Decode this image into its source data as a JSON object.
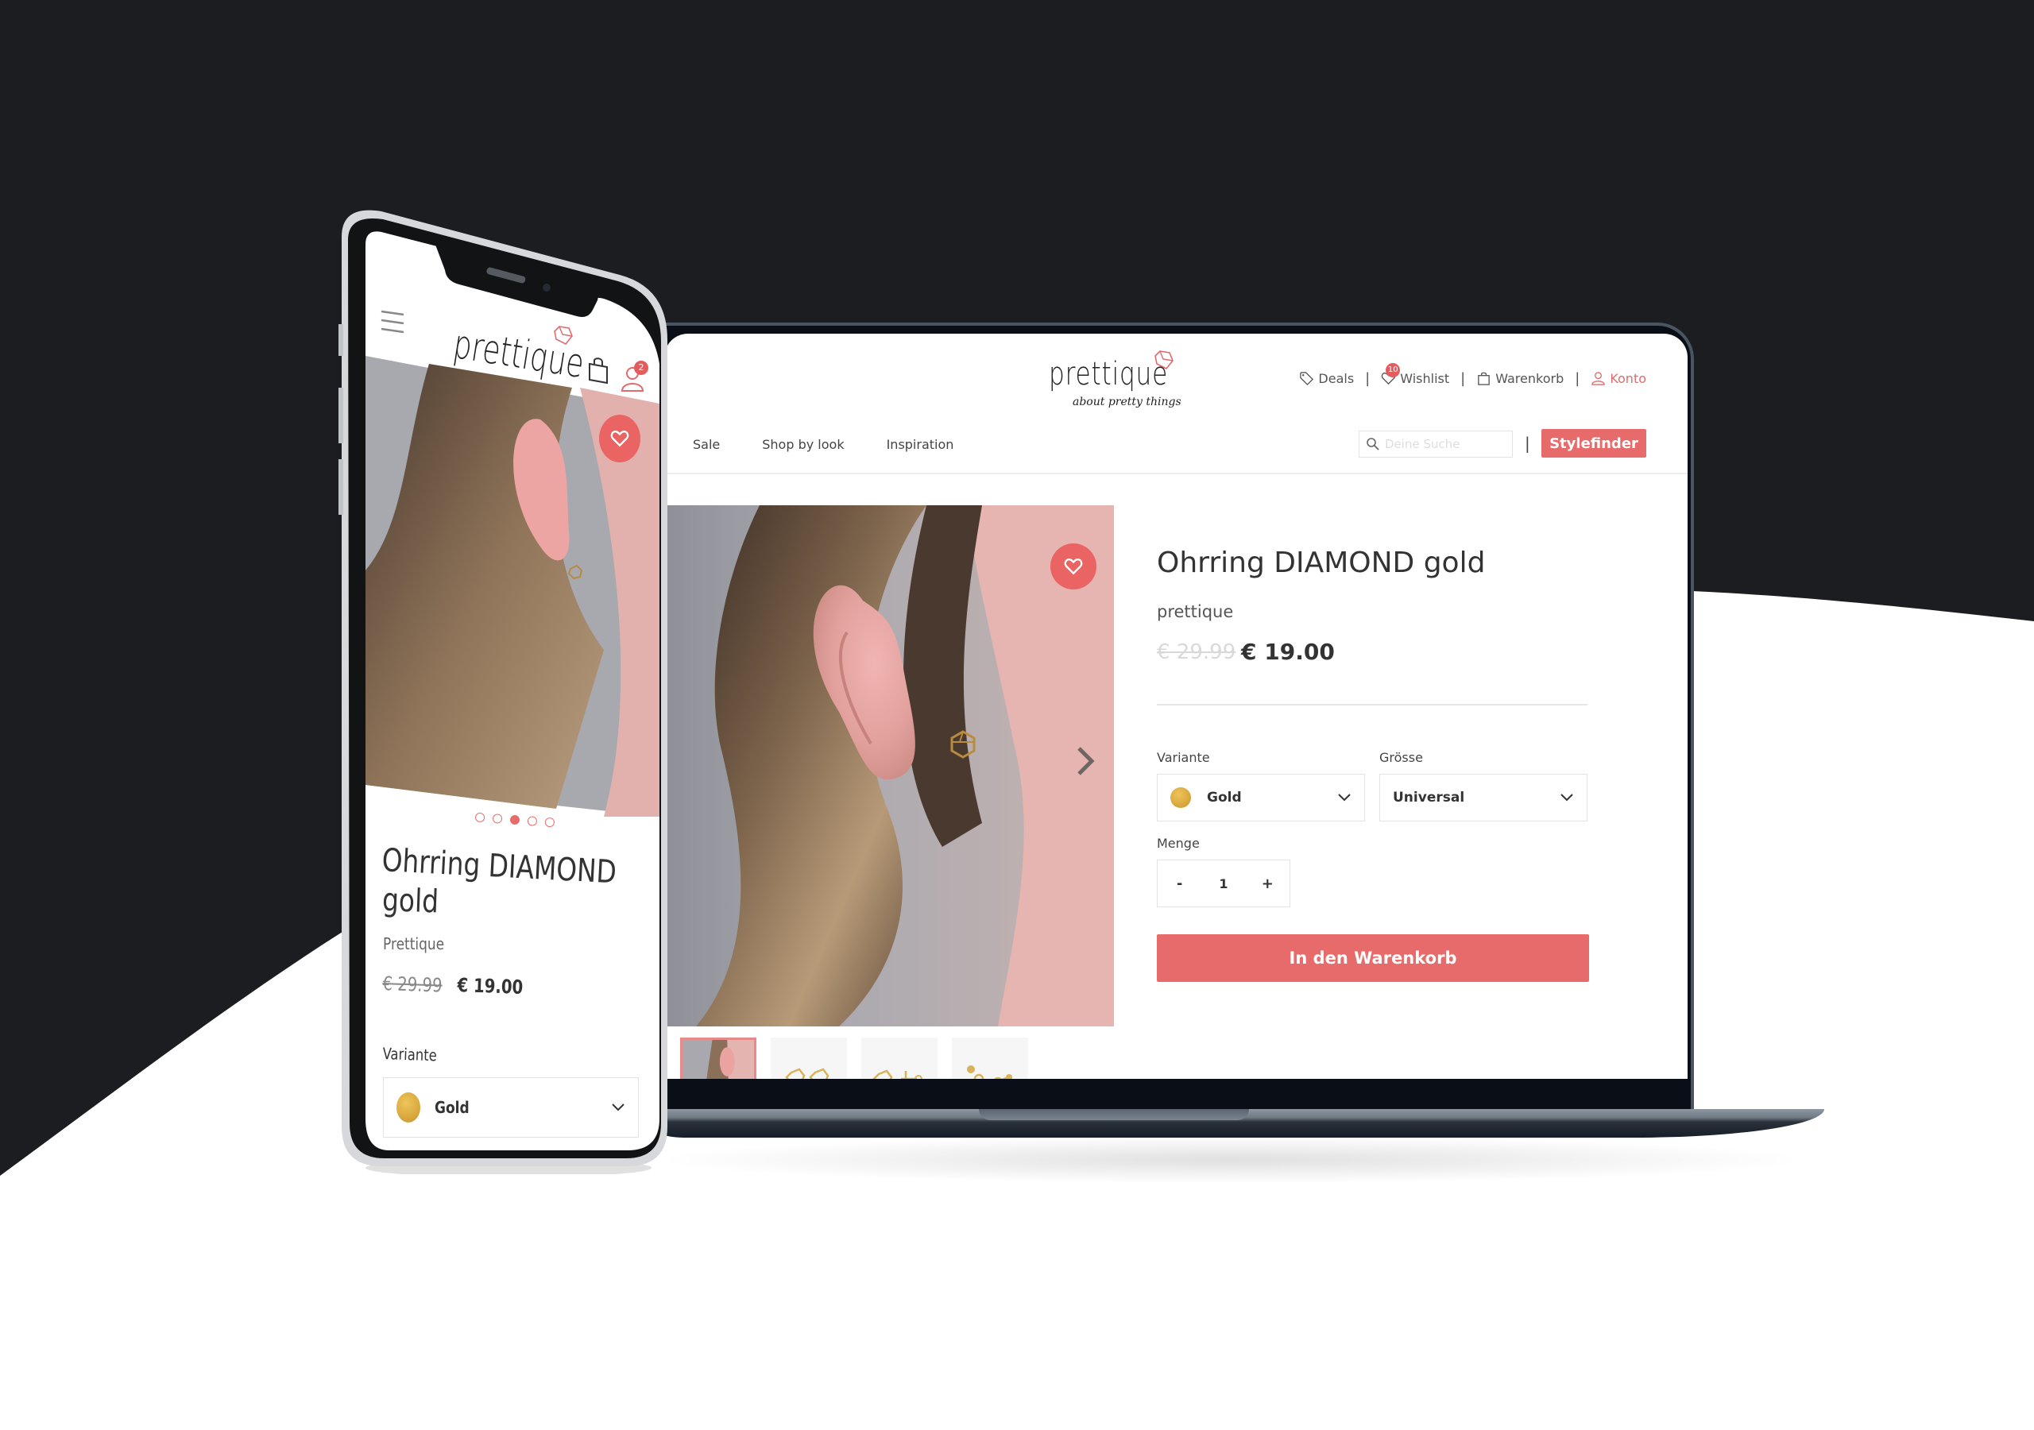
{
  "brand": {
    "name": "prettique",
    "tagline": "about pretty things",
    "accent_color": "#e86b6b",
    "dark_bg": "#1b1d20"
  },
  "desktop": {
    "top_links": [
      {
        "label": "Deals",
        "icon": "tag-icon"
      },
      {
        "label": "Wishlist",
        "icon": "heart-icon",
        "badge": "10"
      },
      {
        "label": "Warenkorb",
        "icon": "shopping-bag-icon"
      },
      {
        "label": "Konto",
        "icon": "user-icon"
      }
    ],
    "separator": "|",
    "nav": [
      "Sale",
      "Shop by look",
      "Inspiration"
    ],
    "search": {
      "placeholder": "Deine Suche",
      "value": ""
    },
    "stylefinder_label": "Stylefinder",
    "product": {
      "title": "Ohrring DIAMOND gold",
      "brand": "prettique",
      "old_price": "€ 29.99",
      "price": "€ 19.00",
      "variant_label": "Variante",
      "variant_value": "Gold",
      "size_label": "Grösse",
      "size_value": "Universal",
      "qty_label": "Menge",
      "qty_minus": "-",
      "qty_value": "1",
      "qty_plus": "+",
      "add_to_cart_label": "In den Warenkorb"
    },
    "thumbnails": [
      {
        "name": "model-ear-photo",
        "active": true
      },
      {
        "name": "earring-pair-front",
        "active": false
      },
      {
        "name": "earring-side-post",
        "active": false
      },
      {
        "name": "earring-backs",
        "active": false
      }
    ]
  },
  "mobile": {
    "cart_badge": "2",
    "carousel": {
      "total": 5,
      "active_index": 2
    },
    "product": {
      "title_line1": "Ohrring DIAMOND",
      "title_line2": "gold",
      "brand": "Prettique",
      "old_price": "€ 29.99",
      "price": "€ 19.00",
      "variant_label": "Variante",
      "variant_value": "Gold"
    }
  }
}
